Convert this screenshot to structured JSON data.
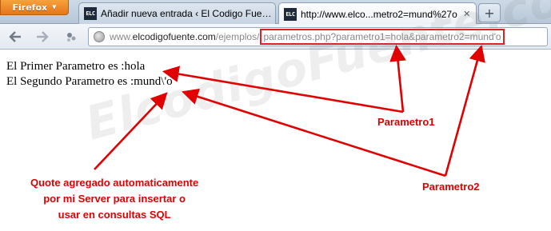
{
  "browser": {
    "menu_label": "Firefox",
    "tabs": [
      {
        "favicon": "ELC",
        "title": "Añadir nueva entrada ‹ El Codigo Fue…",
        "active": false
      },
      {
        "favicon": "ELC",
        "title": "http://www.elco...metro2=mund%27o",
        "active": true
      }
    ],
    "new_tab_label": "+"
  },
  "nav": {
    "back_icon": "back-arrow-icon",
    "forward_icon": "forward-arrow-icon",
    "addon_icon": "addon-icon",
    "url": {
      "prefix_dim": "www.",
      "host": "elcodigofuente.com",
      "path_dim": "/ejemplos/",
      "highlighted": "parametros.php?parametro1=hola&parametro2=mund'o"
    }
  },
  "page": {
    "line1": "El Primer Parametro es :hola",
    "line2": "El Segundo Parametro es :mund\\'o"
  },
  "watermark": "ElcodigoFuente.com",
  "annotations": {
    "parametro1": "Parametro1",
    "parametro2": "Parametro2",
    "quote_note": [
      "Quote agregado automaticamente",
      "por mi Server para insertar o",
      "usar en consultas SQL"
    ],
    "color": "#e00000"
  }
}
